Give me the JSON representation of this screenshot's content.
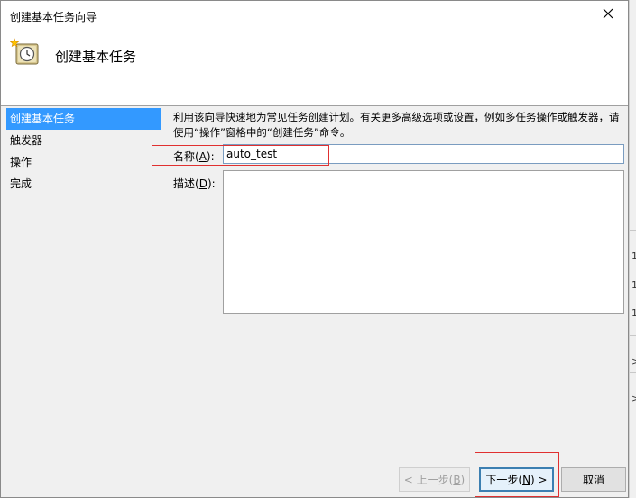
{
  "window": {
    "title": "创建基本任务向导",
    "close_symbol": "✕"
  },
  "header": {
    "title": "创建基本任务",
    "icon": "scheduled-task-clock-icon"
  },
  "sidebar": {
    "items": [
      {
        "label": "创建基本任务",
        "active": true
      },
      {
        "label": "触发器",
        "active": false
      },
      {
        "label": "操作",
        "active": false
      },
      {
        "label": "完成",
        "active": false
      }
    ]
  },
  "main": {
    "description": "利用该向导快速地为常见任务创建计划。有关更多高级选项或设置，例如多任务操作或触发器，请使用“操作”窗格中的“创建任务”命令。",
    "name_label_prefix": "名称(",
    "name_label_key": "A",
    "name_label_suffix": "):",
    "name_value": "auto_test",
    "desc_label_prefix": "描述(",
    "desc_label_key": "D",
    "desc_label_suffix": "):",
    "desc_value": ""
  },
  "buttons": {
    "back_prefix": "< 上一步(",
    "back_key": "B",
    "back_suffix": ")",
    "next_prefix": "下一步(",
    "next_key": "N",
    "next_suffix": ") >",
    "cancel": "取消"
  },
  "background": {
    "chars": [
      "1",
      "1",
      "1",
      ">",
      ">"
    ]
  },
  "colors": {
    "selection": "#3399ff",
    "highlight": "#e03030",
    "panel": "#f0f0f0"
  }
}
